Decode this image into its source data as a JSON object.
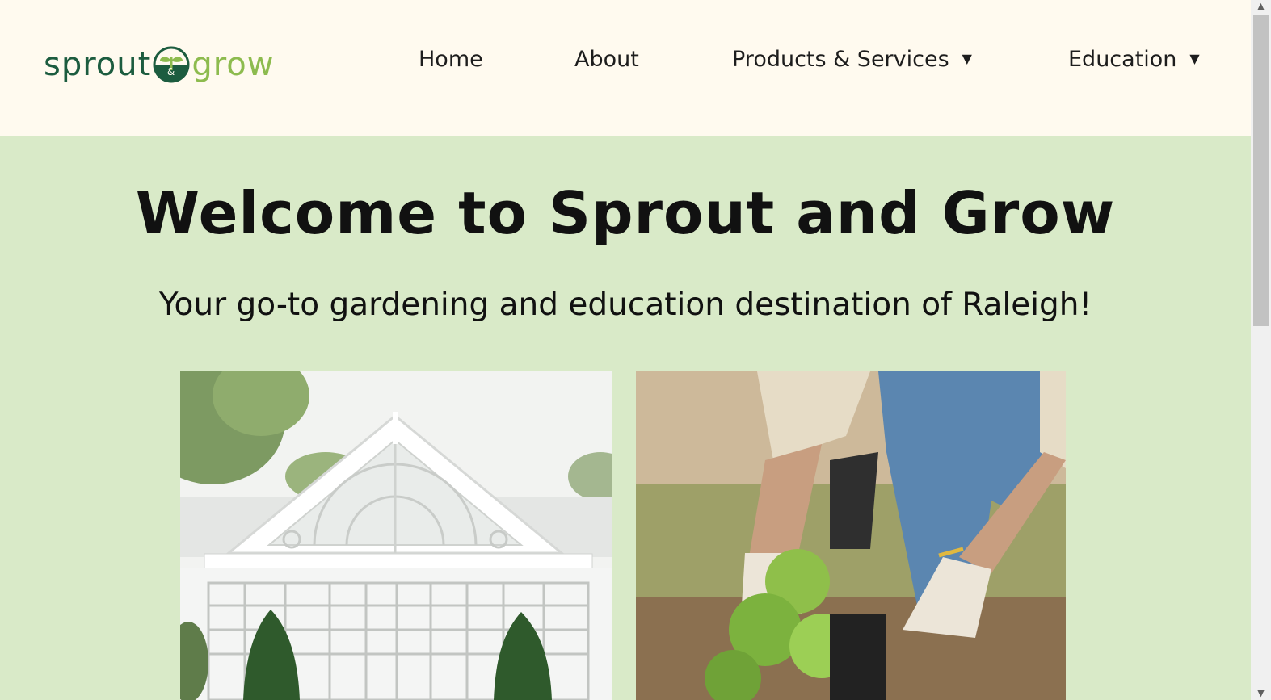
{
  "brand": {
    "name_part1": "sprout",
    "name_part2": "grow",
    "mark_letter": "&",
    "colors": {
      "dark_green": "#1c5c3f",
      "light_green": "#8dbb4e",
      "header_bg": "#fffaef",
      "hero_bg": "#d9eac8"
    }
  },
  "nav": {
    "home": "Home",
    "about": "About",
    "products": "Products & Services",
    "education": "Education",
    "caret": "▼"
  },
  "hero": {
    "title": "Welcome to Sprout and Grow",
    "subtitle": "Your go-to gardening and education destination of Raleigh!"
  },
  "images": {
    "left": "greenhouse-photo",
    "right": "gardener-planting-photo"
  },
  "scrollbar": {
    "up": "▲",
    "down": "▼"
  }
}
